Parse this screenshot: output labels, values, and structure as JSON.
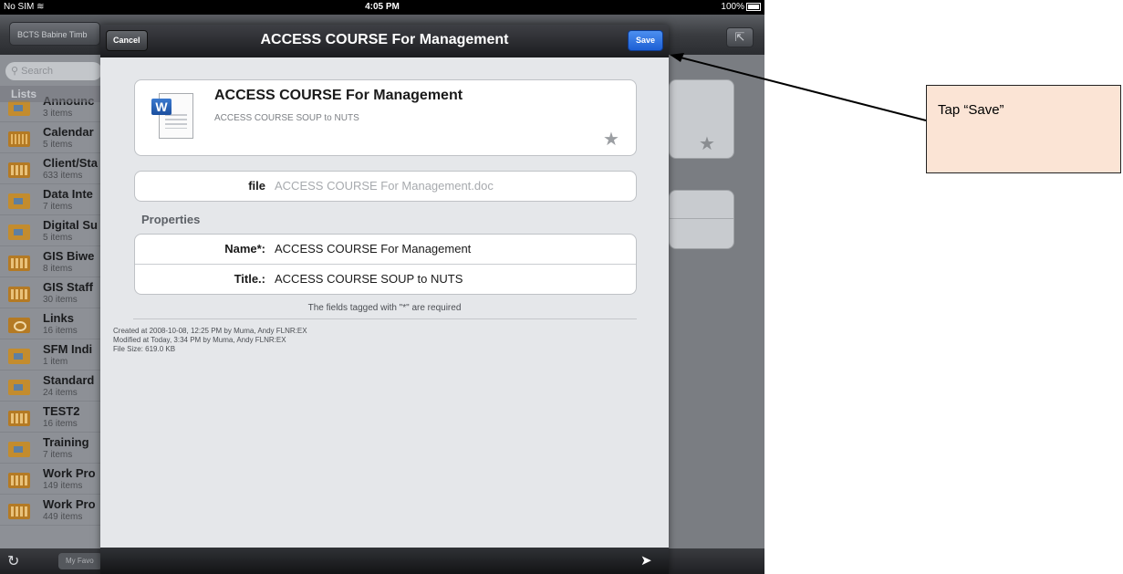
{
  "status_bar": {
    "carrier": "No SIM",
    "time": "4:05 PM",
    "battery": "100%"
  },
  "background_app": {
    "back_button": "BCTS Babine Timb",
    "search_placeholder": "Search",
    "lists_header": "Lists",
    "list_items": [
      {
        "title": "Announc",
        "count": "3 items",
        "icon": "announcement-icon"
      },
      {
        "title": "Calendar",
        "count": "5 items",
        "icon": "calendar-icon"
      },
      {
        "title": "Client/Sta",
        "count": "633 items",
        "icon": "table-icon"
      },
      {
        "title": "Data Inte",
        "count": "7 items",
        "icon": "folder-icon"
      },
      {
        "title": "Digital Su",
        "count": "5 items",
        "icon": "folder-icon"
      },
      {
        "title": "GIS Biwe",
        "count": "8 items",
        "icon": "table-icon"
      },
      {
        "title": "GIS Staff",
        "count": "30 items",
        "icon": "table-icon"
      },
      {
        "title": "Links",
        "count": "16 items",
        "icon": "link-icon"
      },
      {
        "title": "SFM Indi",
        "count": "1 item",
        "icon": "folder-icon"
      },
      {
        "title": "Standard",
        "count": "24 items",
        "icon": "folder-icon"
      },
      {
        "title": "TEST2",
        "count": "16 items",
        "icon": "table-icon"
      },
      {
        "title": "Training",
        "count": "7 items",
        "icon": "folder-icon"
      },
      {
        "title": "Work Pro",
        "count": "149 items",
        "icon": "table-icon"
      },
      {
        "title": "Work Pro",
        "count": "449 items",
        "icon": "table-icon"
      }
    ],
    "favorites_button": "My Favo"
  },
  "modal": {
    "title": "ACCESS COURSE For Management",
    "cancel_label": "Cancel",
    "save_label": "Save",
    "document": {
      "name": "ACCESS COURSE For Management",
      "subtitle": "ACCESS COURSE SOUP to NUTS",
      "icon": "word-document-icon"
    },
    "file": {
      "label": "file",
      "value": "ACCESS COURSE For Management.doc"
    },
    "properties_header": "Properties",
    "properties": [
      {
        "label": "Name*:",
        "value": "ACCESS COURSE For Management"
      },
      {
        "label": "Title.:",
        "value": "ACCESS COURSE SOUP to NUTS"
      }
    ],
    "required_note": "The fields tagged with \"*\" are required",
    "meta": {
      "created": "Created at 2008-10-08, 12:25 PM by Muma, Andy FLNR:EX",
      "modified": "Modified at Today, 3:34 PM by Muma, Andy FLNR:EX",
      "size": "File Size: 619.0 KB"
    }
  },
  "callout": {
    "text": "Tap “Save”"
  }
}
